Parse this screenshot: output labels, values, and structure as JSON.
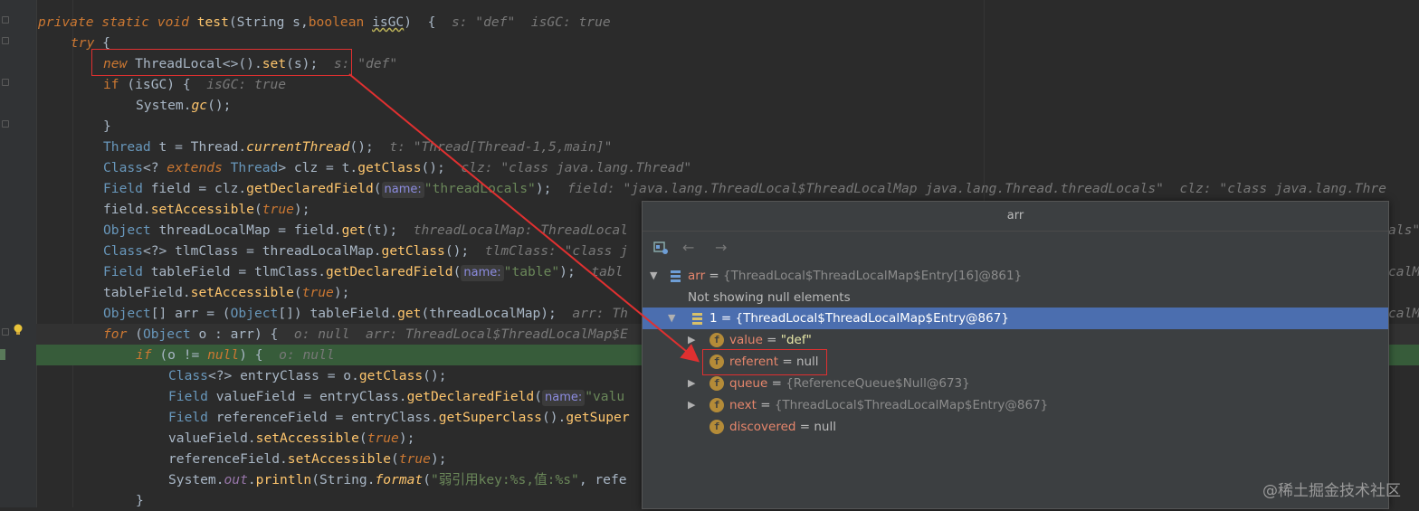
{
  "code": {
    "lines": [
      {
        "parts": [
          [
            "kw it",
            "private static void "
          ],
          [
            "fn",
            "test"
          ],
          [
            "",
            "(String s,"
          ],
          [
            "kw",
            "boolean "
          ],
          [
            "underline-w",
            "isGC"
          ],
          [
            "",
            ")  {"
          ],
          [
            "hint",
            "  s: \"def\"  isGC: true"
          ]
        ]
      },
      {
        "parts": [
          [
            "kw it",
            "try "
          ],
          [
            "",
            "{"
          ]
        ]
      },
      {
        "parts": [
          [
            "kw it",
            "new "
          ],
          [
            "",
            "ThreadLocal<>()."
          ],
          [
            "fn",
            "set"
          ],
          [
            "",
            "(s);"
          ],
          [
            "hint",
            "  s: \"def\""
          ]
        ]
      },
      {
        "parts": [
          [
            "kw",
            "if "
          ],
          [
            "",
            "(isGC) {"
          ],
          [
            "hint",
            "  isGC: true"
          ]
        ]
      },
      {
        "parts": [
          [
            "",
            "System."
          ],
          [
            "static",
            "gc"
          ],
          [
            "",
            "();"
          ]
        ]
      },
      {
        "parts": [
          [
            "",
            "}"
          ]
        ]
      },
      {
        "parts": [
          [
            "cls",
            "Thread "
          ],
          [
            "",
            "t = Thread."
          ],
          [
            "static",
            "currentThread"
          ],
          [
            "",
            "();"
          ],
          [
            "hint",
            "  t: \"Thread[Thread-1,5,main]\""
          ]
        ]
      },
      {
        "parts": [
          [
            "cls",
            "Class"
          ],
          [
            "",
            "<? "
          ],
          [
            "kw it",
            "extends "
          ],
          [
            "cls",
            "Thread"
          ],
          [
            "",
            "> clz = t."
          ],
          [
            "fn",
            "getClass"
          ],
          [
            "",
            "();"
          ],
          [
            "hint",
            "  clz: \"class java.lang.Thread\""
          ]
        ]
      },
      {
        "parts": [
          [
            "cls",
            "Field "
          ],
          [
            "",
            "field = clz."
          ],
          [
            "fn",
            "getDeclaredField"
          ],
          [
            "",
            "("
          ],
          [
            "pname",
            "name:"
          ],
          [
            "str",
            "\"threadLocals\""
          ],
          [
            "",
            ");"
          ],
          [
            "hint",
            "  field: \"java.lang.ThreadLocal$ThreadLocalMap java.lang.Thread.threadLocals\"  clz: \"class java.lang.Thre"
          ]
        ]
      },
      {
        "parts": [
          [
            "",
            "field."
          ],
          [
            "fn",
            "setAccessible"
          ],
          [
            "",
            "("
          ],
          [
            "kw it",
            "true"
          ],
          [
            "",
            ");"
          ]
        ]
      },
      {
        "parts": [
          [
            "cls",
            "Object "
          ],
          [
            "",
            "threadLocalMap = field."
          ],
          [
            "fn",
            "get"
          ],
          [
            "",
            "(t);"
          ],
          [
            "hint",
            "  threadLocalMap: ThreadLocal"
          ]
        ]
      },
      {
        "parts": [
          [
            "cls",
            "Class"
          ],
          [
            "",
            "<?> tlmClass = threadLocalMap."
          ],
          [
            "fn",
            "getClass"
          ],
          [
            "",
            "();"
          ],
          [
            "hint",
            "  tlmClass: \"class j"
          ]
        ]
      },
      {
        "parts": [
          [
            "cls",
            "Field "
          ],
          [
            "",
            "tableField = tlmClass."
          ],
          [
            "fn",
            "getDeclaredField"
          ],
          [
            "",
            "("
          ],
          [
            "pname",
            "name:"
          ],
          [
            "str",
            "\"table\""
          ],
          [
            "",
            ");"
          ],
          [
            "hint",
            "  tabl"
          ]
        ]
      },
      {
        "parts": [
          [
            "",
            "tableField."
          ],
          [
            "fn",
            "setAccessible"
          ],
          [
            "",
            "("
          ],
          [
            "kw it",
            "true"
          ],
          [
            "",
            ");"
          ]
        ]
      },
      {
        "parts": [
          [
            "cls",
            "Object"
          ],
          [
            "",
            "[] arr = ("
          ],
          [
            "cls",
            "Object"
          ],
          [
            "",
            "[]) tableField."
          ],
          [
            "fn",
            "get"
          ],
          [
            "",
            "(threadLocalMap);"
          ],
          [
            "hint",
            "  arr: Th"
          ]
        ]
      },
      {
        "parts": [
          [
            "kw it",
            "for "
          ],
          [
            "",
            "("
          ],
          [
            "cls",
            "Object "
          ],
          [
            "",
            "o : arr) {"
          ],
          [
            "hint",
            "  o: null  arr: ThreadLocal$ThreadLocalMap$E"
          ]
        ]
      },
      {
        "parts": [
          [
            "kw it",
            "if "
          ],
          [
            "",
            "(o != "
          ],
          [
            "kw it",
            "null"
          ],
          [
            "",
            ") {"
          ],
          [
            "hint",
            "  o: null"
          ]
        ]
      },
      {
        "parts": [
          [
            "cls",
            "Class"
          ],
          [
            "",
            "<?> entryClass = o."
          ],
          [
            "fn",
            "getClass"
          ],
          [
            "",
            "();"
          ]
        ]
      },
      {
        "parts": [
          [
            "cls",
            "Field "
          ],
          [
            "",
            "valueField = entryClass."
          ],
          [
            "fn",
            "getDeclaredField"
          ],
          [
            "",
            "("
          ],
          [
            "pname",
            "name:"
          ],
          [
            "str",
            "\"valu"
          ]
        ]
      },
      {
        "parts": [
          [
            "cls",
            "Field "
          ],
          [
            "",
            "referenceField = entryClass."
          ],
          [
            "fn",
            "getSuperclass"
          ],
          [
            "",
            "()."
          ],
          [
            "fn",
            "getSuper"
          ]
        ]
      },
      {
        "parts": [
          [
            "",
            "valueField."
          ],
          [
            "fn",
            "setAccessible"
          ],
          [
            "",
            "("
          ],
          [
            "kw it",
            "true"
          ],
          [
            "",
            ");"
          ]
        ]
      },
      {
        "parts": [
          [
            "",
            "referenceField."
          ],
          [
            "fn",
            "setAccessible"
          ],
          [
            "",
            "("
          ],
          [
            "kw it",
            "true"
          ],
          [
            "",
            ");"
          ]
        ]
      },
      {
        "parts": [
          [
            "",
            "System."
          ],
          [
            "field it",
            "out"
          ],
          [
            "",
            "."
          ],
          [
            "fn",
            "println"
          ],
          [
            "",
            "(String."
          ],
          [
            "static",
            "format"
          ],
          [
            "",
            "("
          ],
          [
            "str",
            "\"弱引用key:%s,值:%s\""
          ],
          [
            "",
            ", refe"
          ]
        ]
      },
      {
        "parts": [
          [
            "",
            "}"
          ]
        ]
      }
    ]
  },
  "popup": {
    "title": "arr",
    "toolbar_icons": [
      "watch-icon",
      "back-arrow-icon",
      "forward-arrow-icon"
    ],
    "rows": [
      {
        "name": "arr",
        "eq": " = ",
        "value": "{ThreadLocal$ThreadLocalMap$Entry[16]@861}",
        "value_class": "gray"
      },
      {
        "note": "Not showing null elements"
      },
      {
        "name": "1",
        "eq": " = ",
        "value": "{ThreadLocal$ThreadLocalMap$Entry@867}",
        "value_class": "white"
      },
      {
        "name": "value",
        "eq": " = ",
        "value": "\"def\"",
        "value_class": "green"
      },
      {
        "name": "referent",
        "eq": " = ",
        "value": "null",
        "value_class": "eq"
      },
      {
        "name": "queue",
        "eq": " = ",
        "value": "{ReferenceQueue$Null@673}",
        "value_class": "gray"
      },
      {
        "name": "next",
        "eq": " = ",
        "value": "{ThreadLocal$ThreadLocalMap$Entry@867}",
        "value_class": "gray"
      },
      {
        "name": "discovered",
        "eq": " = ",
        "value": "null",
        "value_class": "eq"
      }
    ],
    "field_icon_letter": "f"
  },
  "overflow_right": [
    {
      "text": "als\""
    },
    {
      "text": "calM"
    },
    {
      "text": "calMa"
    }
  ],
  "watermark": "@稀土掘金技术社区",
  "colors": {
    "annotation": "#e03030",
    "selection": "#4b6eaf",
    "exec_line": "#375c3a"
  }
}
